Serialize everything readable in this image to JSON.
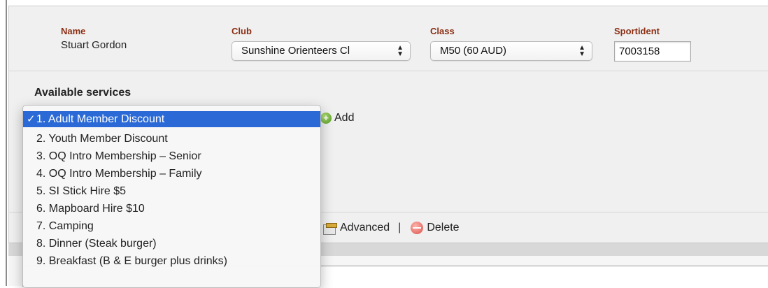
{
  "entry": {
    "name_label": "Name",
    "name_value": "Stuart Gordon",
    "club_label": "Club",
    "club_value": "Sunshine Orienteers Cl",
    "class_label": "Class",
    "class_value": "M50 (60 AUD)",
    "sportident_label": "Sportident",
    "sportident_value": "7003158"
  },
  "services": {
    "title": "Available services",
    "add_label": "Add",
    "options": [
      "1. Adult Member Discount",
      "2. Youth Member Discount",
      "3. OQ Intro Membership – Senior",
      "4. OQ Intro Membership – Family",
      "5. SI Stick Hire $5",
      "6. Mapboard Hire $10",
      "7. Camping",
      "8. Dinner (Steak burger)",
      "9. Breakfast (B & E burger plus drinks)"
    ],
    "selected_index": 0,
    "selected_mark": "✓"
  },
  "actions": {
    "advanced_label": "Advanced",
    "separator": "|",
    "delete_label": "Delete"
  },
  "icons": {
    "select_arrows": "▲▼",
    "add_icon": "add-icon",
    "advanced_icon": "advanced-icon",
    "delete_icon": "delete-icon"
  },
  "colors": {
    "label_color": "#8b2d12",
    "selected_bg": "#2b6ad6"
  }
}
